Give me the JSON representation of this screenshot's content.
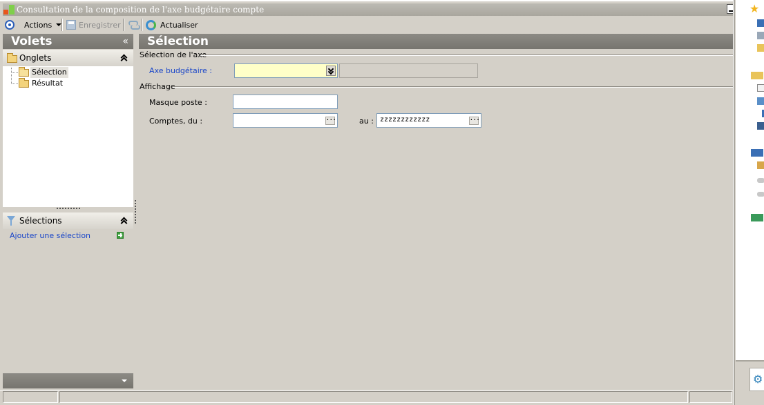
{
  "window": {
    "title": "Consultation de la composition de l'axe budgétaire compte"
  },
  "toolbar": {
    "actions_label": "Actions",
    "save_label": "Enregistrer",
    "refresh_label": "Actualiser"
  },
  "sidebar": {
    "title": "Volets",
    "collapse_glyph": "«",
    "onglets": {
      "label": "Onglets",
      "items": [
        {
          "label": "Sélection",
          "selected": true
        },
        {
          "label": "Résultat",
          "selected": false
        }
      ]
    },
    "selections": {
      "label": "Sélections",
      "add_link": "Ajouter une sélection"
    }
  },
  "main": {
    "title": "Sélection",
    "axis_group": {
      "legend": "Sélection de l'axe",
      "axe_label": "Axe budgétaire :",
      "axe_value": "",
      "axe_description": ""
    },
    "display_group": {
      "legend": "Affichage",
      "masque_label": "Masque poste :",
      "masque_value": "",
      "comptes_from_label": "Comptes, du :",
      "comptes_from_value": "",
      "comptes_to_label": "au :",
      "comptes_to_value": "zzzzzzzzzzzz"
    }
  },
  "icons": {
    "actions": "circle-target-icon",
    "save": "save-icon",
    "sync": "sync-icon",
    "refresh": "refresh-icon",
    "favorites": "star-icon",
    "settings": "gear-icon"
  },
  "colors": {
    "required_field_bg": "#ffffc8",
    "link": "#1a46c9",
    "header_bar": "#807e79"
  }
}
